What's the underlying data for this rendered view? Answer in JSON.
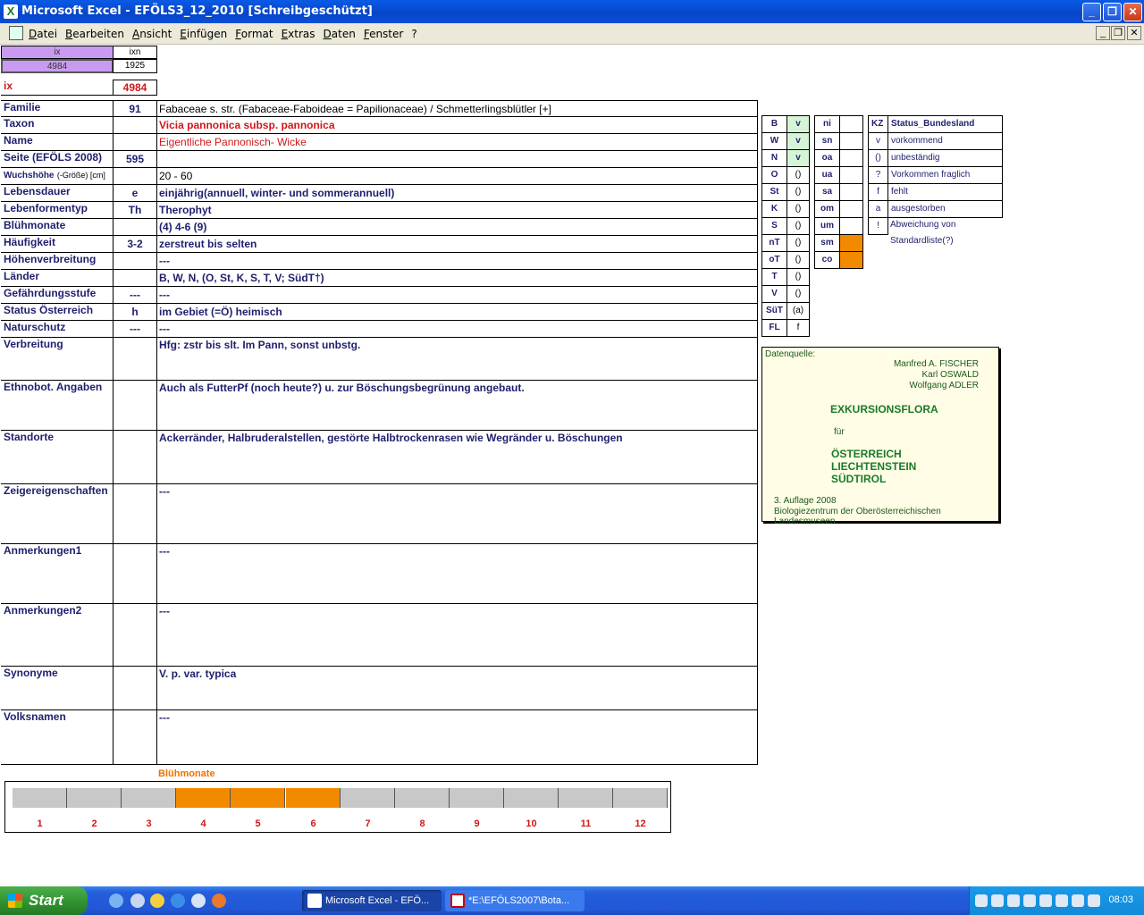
{
  "window": {
    "title": "Microsoft Excel - EFÖLS3_12_2010  [Schreibgeschützt]",
    "minimize": "_",
    "restore": "❐",
    "close": "✕"
  },
  "menu": {
    "items": [
      "Datei",
      "Bearbeiten",
      "Ansicht",
      "Einfügen",
      "Format",
      "Extras",
      "Daten",
      "Fenster",
      "?"
    ],
    "mdi_minimize": "_",
    "mdi_restore": "❐",
    "mdi_close": "✕"
  },
  "header": {
    "ix_label": "ix",
    "ixn_label": "ixn",
    "ix_value": "4984",
    "ixn_value": "1925",
    "ix_big_label": "ix",
    "ix_big_value": "4984"
  },
  "rows": [
    {
      "label": "Familie",
      "code": "91",
      "value": "Fabaceae s. str. (Fabaceae-Faboideae = Papilionaceae)  /  Schmetterlingsblütler [+]"
    },
    {
      "label": "Taxon",
      "code": "",
      "value": "Vicia pannonica subsp. pannonica"
    },
    {
      "label": "Name",
      "code": "",
      "value": "Eigentliche Pannonisch- Wicke"
    },
    {
      "label": "Seite (EFÖLS 2008)",
      "code": "595",
      "value": ""
    },
    {
      "label": "Wuchshöhe",
      "label_suffix": "(-Größe) [cm]",
      "code": "",
      "value": " 20 - 60"
    },
    {
      "label": "Lebensdauer",
      "code": "e",
      "value": "einjährig(annuell, winter- und sommerannuell)"
    },
    {
      "label": "Lebenformentyp",
      "code": "Th",
      "value": "Therophyt"
    },
    {
      "label": "Blühmonate",
      "code": "",
      "value": "(4) 4-6 (9)"
    },
    {
      "label": "Häufigkeit",
      "code": "3-2",
      "value": "zerstreut bis selten"
    },
    {
      "label": "Höhenverbreitung",
      "code": "",
      "value": "---"
    },
    {
      "label": "Länder",
      "code": "",
      "value": "B, W, N, (O, St, K, S, T, V; SüdT†)"
    },
    {
      "label": "Gefährdungsstufe",
      "code": "---",
      "value": "  ---"
    },
    {
      "label": "Status Österreich",
      "code": "h",
      "value": "im Gebiet (=Ö) heimisch"
    },
    {
      "label": "Naturschutz",
      "code": "---",
      "value": "---"
    },
    {
      "label": "Verbreitung",
      "code": "",
      "value": "Hfg: zstr bis slt. Im Pann, sonst unbstg."
    },
    {
      "label": "Ethnobot. Angaben",
      "code": "",
      "value": "Auch als FutterPf (noch heute?) u. zur Böschungsbegrünung angebaut."
    },
    {
      "label": "Standorte",
      "code": "",
      "value": "Ackerränder, Halbruderalstellen, gestörte Halbtrockenrasen wie Wegränder u. Böschungen"
    },
    {
      "label": "Zeigereigenschaften",
      "code": "",
      "value": "---"
    },
    {
      "label": "Anmerkungen1",
      "code": "",
      "value": "---"
    },
    {
      "label": "Anmerkungen2",
      "code": "",
      "value": "---"
    },
    {
      "label": "Synonyme",
      "code": "",
      "value": "V. p. var. typica"
    },
    {
      "label": "Volksnamen",
      "code": "",
      "value": "---"
    }
  ],
  "states": [
    {
      "code": "B",
      "value": "v"
    },
    {
      "code": "W",
      "value": "v"
    },
    {
      "code": "N",
      "value": "v"
    },
    {
      "code": "O",
      "value": "()"
    },
    {
      "code": "St",
      "value": "()"
    },
    {
      "code": "K",
      "value": "()"
    },
    {
      "code": "S",
      "value": "()"
    },
    {
      "code": "nT",
      "value": "()"
    },
    {
      "code": "oT",
      "value": "()"
    },
    {
      "code": "T",
      "value": "()"
    },
    {
      "code": "V",
      "value": "()"
    },
    {
      "code": "SüT",
      "value": "(a)"
    },
    {
      "code": "FL",
      "value": "f"
    }
  ],
  "regions": [
    {
      "code": "ni",
      "value": ""
    },
    {
      "code": "sn",
      "value": ""
    },
    {
      "code": "oa",
      "value": ""
    },
    {
      "code": "ua",
      "value": ""
    },
    {
      "code": "sa",
      "value": ""
    },
    {
      "code": "om",
      "value": ""
    },
    {
      "code": "um",
      "value": ""
    },
    {
      "code": "sm",
      "value": ""
    },
    {
      "code": "co",
      "value": ""
    }
  ],
  "legend": {
    "kz_header": "KZ",
    "status_header": "Status_Bundesland",
    "items": [
      {
        "kz": "v",
        "text": "vorkommend"
      },
      {
        "kz": "()",
        "text": "unbeständig"
      },
      {
        "kz": "?",
        "text": "Vorkommen fraglich"
      },
      {
        "kz": "f",
        "text": "fehlt"
      },
      {
        "kz": "a",
        "text": "ausgestorben"
      },
      {
        "kz": "!",
        "text": "Abweichung von Standardliste(?)"
      }
    ]
  },
  "datenquelle": {
    "label": "Datenquelle:",
    "author1": "Manfred A. FISCHER",
    "author2": "Karl OSWALD",
    "author3": "Wolfgang ADLER",
    "title": "EXKURSIONSFLORA",
    "fuer": "für",
    "country1": "ÖSTERREICH",
    "country2": "LIECHTENSTEIN",
    "country3": "SÜDTIROL",
    "edition": "3. Auflage 2008",
    "publisher": "Biologiezentrum der Oberösterreichischen Landesmuseen"
  },
  "colors": {
    "highlight": "#f28a00",
    "inactive": "#c8c8c8",
    "label_blue": "#1f1f6e",
    "red": "#d01818",
    "purple": "#c89bf0",
    "green_cell": "#d6f5d6"
  },
  "chart_data": {
    "type": "bar",
    "title": "Blühmonate",
    "categories": [
      "1",
      "2",
      "3",
      "4",
      "5",
      "6",
      "7",
      "8",
      "9",
      "10",
      "11",
      "12"
    ],
    "values": [
      0,
      0,
      0,
      1,
      1,
      1,
      0,
      0,
      0,
      0,
      0,
      0
    ]
  },
  "taskbar": {
    "start": "Start",
    "task1": "Microsoft Excel - EFÖ...",
    "task2": "*E:\\EFÖLS2007\\Bota...",
    "clock": "08:03"
  }
}
